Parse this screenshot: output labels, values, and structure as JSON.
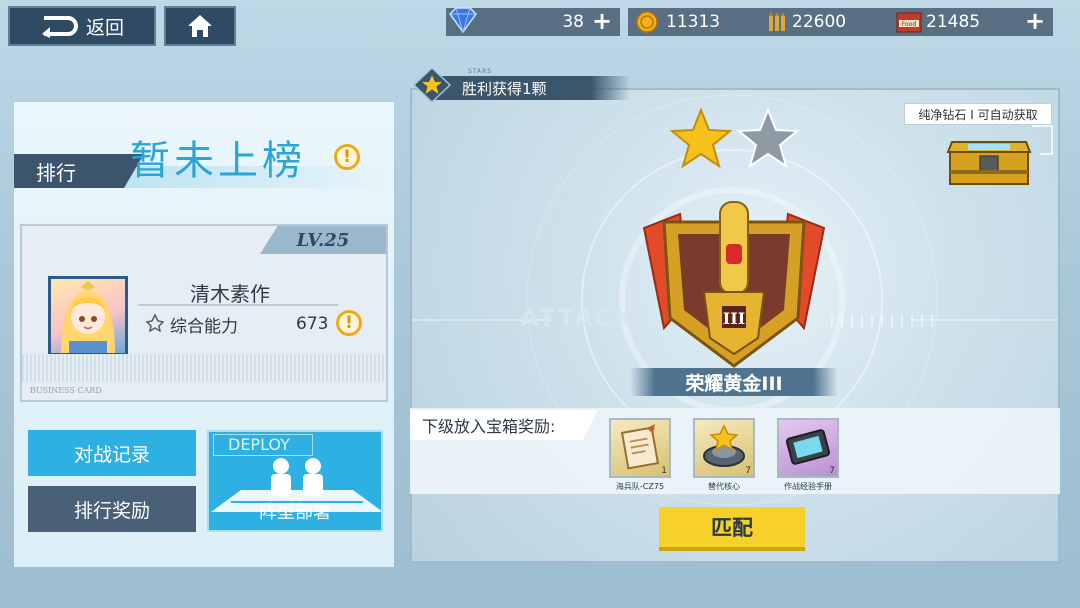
{
  "header": {
    "back_label": "返回",
    "resources": {
      "diamonds": "38",
      "coins": "11313",
      "ammo": "22600",
      "food": "21485",
      "food_icon_label": "Food"
    }
  },
  "left": {
    "rank_label": "排行",
    "rank_status": "暂未上榜",
    "card": {
      "level": "LV.25",
      "name": "清木素作",
      "power_label": "综合能力",
      "power_value": "673",
      "card_type": "BUSINESS CARD"
    },
    "buttons": {
      "battle_record": "对战记录",
      "rank_reward": "排行奖励",
      "deploy_title": "DEPLOY",
      "deploy_label": "阵型部署"
    }
  },
  "right": {
    "stars_label": "STARS",
    "victory_text": "胜利获得1颗",
    "stars_earned": 1,
    "stars_total": 2,
    "chest_note": "纯净钻石 I 可自动获取",
    "bg_word": "ATTACK",
    "rank_numeral": "III",
    "rank_name": "荣耀黄金III",
    "reward_label": "下级放入宝箱奖励:",
    "rewards": [
      {
        "name": "海兵队-CZ75",
        "count": "1"
      },
      {
        "name": "替代核心",
        "count": "7"
      },
      {
        "name": "作战经验手册",
        "count": "7"
      }
    ],
    "match_label": "匹配"
  },
  "colors": {
    "accent_blue": "#2fb0e2",
    "dark_slate": "#3c556c",
    "gold": "#f5c11a",
    "warning": "#f0a818"
  }
}
